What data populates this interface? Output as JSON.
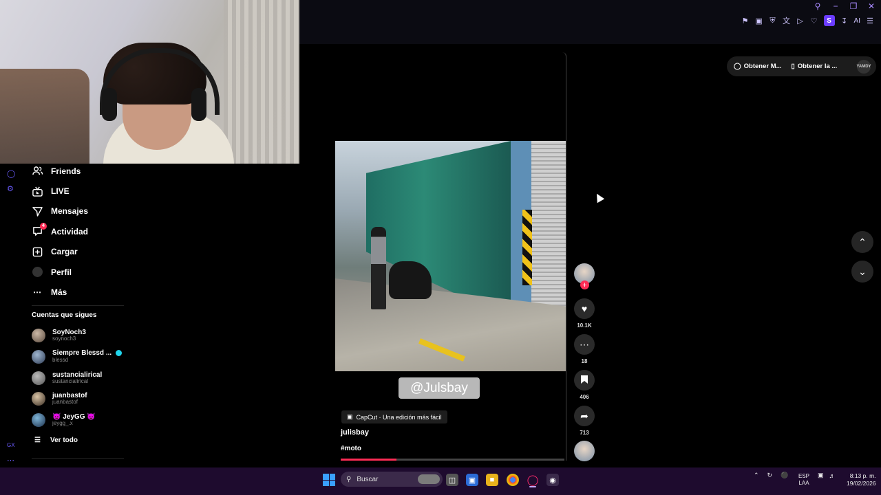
{
  "browser": {
    "toolbar_icons": [
      "pin-icon",
      "crop-icon",
      "shield-icon",
      "translate-icon",
      "play-icon",
      "heart-icon"
    ],
    "profile_badge": "S",
    "ai_label": "AI"
  },
  "sidebar": {
    "items": [
      {
        "label": "Friends",
        "icon": "friends-icon"
      },
      {
        "label": "LIVE",
        "icon": "live-icon"
      },
      {
        "label": "Mensajes",
        "icon": "send-icon"
      },
      {
        "label": "Actividad",
        "icon": "activity-icon",
        "badge": "4"
      },
      {
        "label": "Cargar",
        "icon": "upload-icon"
      },
      {
        "label": "Perfil",
        "icon": "profile-icon"
      },
      {
        "label": "Más",
        "icon": "more-icon"
      }
    ],
    "following_title": "Cuentas que sigues",
    "following": [
      {
        "name": "SoyNoch3",
        "handle": "soynoch3"
      },
      {
        "name": "Siempre Blessd ...",
        "handle": "blessd",
        "verified": true
      },
      {
        "name": "sustancialirical",
        "handle": "sustancialirical"
      },
      {
        "name": "juanbastof",
        "handle": "juanbastof"
      },
      {
        "name": "👿 JeyGG 👿",
        "handle": "jeygg_.x"
      }
    ],
    "see_all": "Ver todo",
    "rail_label": "GX"
  },
  "video": {
    "watermark": "@Julsbay",
    "capcut_label": "CapCut · Una edición más fácil",
    "author": "julisbay",
    "hashtag": "#moto",
    "progress": 0.25
  },
  "actions": {
    "likes": "10.1K",
    "comments": "18",
    "saves": "406",
    "shares": "713"
  },
  "get_bar": {
    "item1": "Obtener M...",
    "item2": "Obtener la ...",
    "avatar_text": "YAMDY"
  },
  "taskbar": {
    "search_placeholder": "Buscar",
    "lang_line1": "ESP",
    "lang_line2": "LAA",
    "time": "8:13 p. m.",
    "date": "19/02/2026"
  },
  "colors": {
    "accent": "#fe2c55",
    "verified": "#20d5ec",
    "taskbar": "#1e0b2e"
  }
}
